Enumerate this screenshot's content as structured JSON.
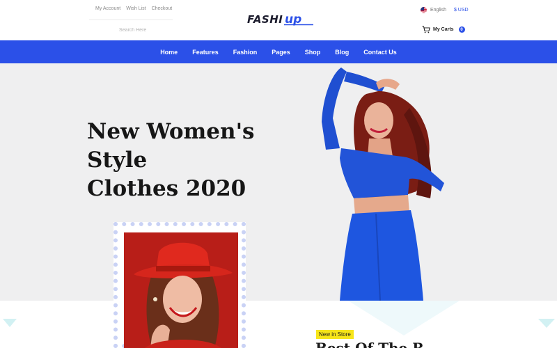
{
  "header": {
    "top_links": [
      "My Account",
      "Wish List",
      "Checkout"
    ],
    "search_placeholder": "Search Here",
    "logo_text": "FASHI",
    "logo_mark": "up",
    "language": "English",
    "currency": "$ USD",
    "cart_label": "My Carts",
    "cart_count": "0"
  },
  "nav": {
    "items": [
      "Home",
      "Features",
      "Fashion",
      "Pages",
      "Shop",
      "Blog",
      "Contact Us"
    ]
  },
  "hero": {
    "title_line1": "New Women's Style",
    "title_line2": "Clothes 2020"
  },
  "promo": {
    "badge": "New in Store",
    "title": "Best Of The R..."
  },
  "colors": {
    "brand": "#2b50e8",
    "hero_bg": "#efeff0",
    "badge": "#f7e51a"
  }
}
